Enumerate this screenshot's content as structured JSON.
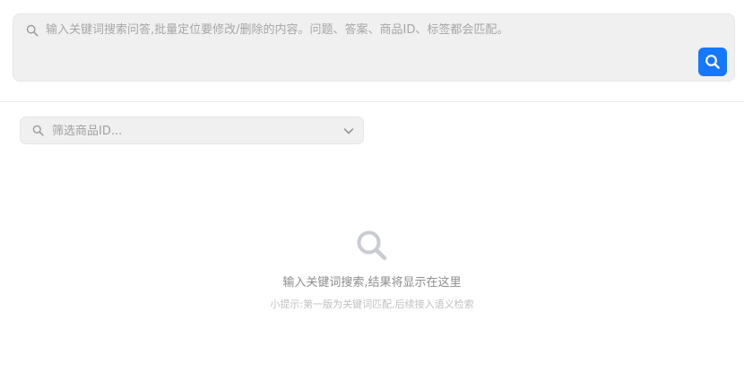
{
  "search": {
    "placeholder": "输入关键词搜索问答,批量定位要修改/删除的内容。问题、答案、商品ID、标签都会匹配。",
    "value": "",
    "button_icon": "search-icon",
    "accent_color": "#1677ff"
  },
  "filter": {
    "placeholder": "筛选商品ID...",
    "value": "",
    "dropdown_icon": "chevron-down-icon"
  },
  "empty_state": {
    "icon": "search-icon",
    "title": "输入关键词搜索,结果将显示在这里",
    "hint": "小提示:第一版为关键词匹配,后续接入语义检索"
  }
}
